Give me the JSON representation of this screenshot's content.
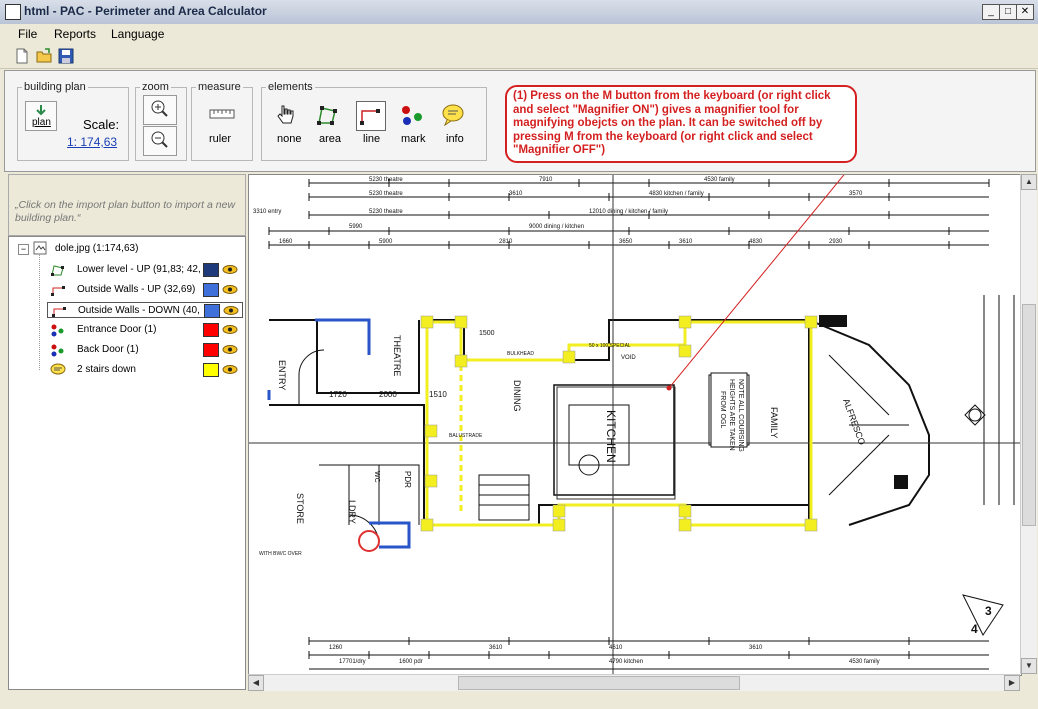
{
  "window": {
    "title": "html - PAC - Perimeter and Area Calculator"
  },
  "menu": [
    "File",
    "Reports",
    "Language"
  ],
  "ribbon": {
    "building_plan": {
      "legend": "building plan",
      "plan_button": "plan",
      "scale_label": "Scale:",
      "scale_value": "1: 174,63"
    },
    "zoom": {
      "legend": "zoom"
    },
    "measure": {
      "legend": "measure",
      "ruler_label": "ruler"
    },
    "elements": {
      "legend": "elements",
      "tools": [
        "none",
        "area",
        "line",
        "mark",
        "info"
      ]
    }
  },
  "callout": {
    "text": "(1) Press on the M button from the keyboard (or right click and select \"Magnifier ON\") gives a magnifier tool for magnifying obejcts on the plan. It can be switched off by pressing M from the keyboard (or right click and select \"Magnifier OFF\")"
  },
  "hint": "„Click on the import plan button to import a new building plan.“",
  "tree": {
    "root": "dole.jpg (1:174,63)",
    "layers": [
      {
        "label": "Lower level - UP (91,83; 42,",
        "color": "#1f3a7a",
        "icon": "polyline-icon"
      },
      {
        "label": "Outside Walls - UP (32,69)",
        "color": "#3f6fd8",
        "icon": "line-icon"
      },
      {
        "label": "Outside Walls - DOWN (40,",
        "color": "#3f6fd8",
        "icon": "line-icon"
      },
      {
        "label": "Entrance Door (1)",
        "color": "#ff0000",
        "icon": "mark-icon"
      },
      {
        "label": "Back Door (1)",
        "color": "#ff0000",
        "icon": "mark-icon"
      },
      {
        "label": "2 stairs down",
        "color": "#ffff00",
        "icon": "info-icon"
      }
    ]
  },
  "plan": {
    "top_dims": [
      "5230 theatre",
      "7910",
      "4530 family",
      "5230 theatre",
      "3610",
      "4830 kitchen / family",
      "3570",
      "5230 theatre",
      "12010 dining / kitchen / family",
      "9000 dining / kitchen",
      "5990",
      "3310 entry",
      "1660",
      "5900",
      "2810",
      "3650",
      "3610",
      "4830",
      "2930"
    ],
    "rooms": [
      "THEATRE",
      "ENTRY",
      "DINING",
      "KITCHEN",
      "FAMILY",
      "ALFRESCO",
      "STORE",
      "LDRY",
      "PDR",
      "WC",
      "VOID"
    ],
    "notes": [
      "NOTE ALL COURSING",
      "HEIGHTS ARE TAKEN",
      "FROM OGL",
      "50 x 100 SPECIAL",
      "BULKHEAD",
      "BALUSTRADE",
      "WITH BW/C OVER"
    ],
    "inner_dims": [
      "1720",
      "2000",
      "1510",
      "1500"
    ],
    "bottom_dims": [
      "1260",
      "3610",
      "4790 kitchen",
      "4530 family",
      "17701/dry",
      "1600 pdr",
      "4610",
      "3610"
    ],
    "numbers": [
      "3",
      "4"
    ]
  },
  "colors": {
    "trace": "#ffff00",
    "handle": "#ffff00",
    "callout": "#d42020"
  }
}
